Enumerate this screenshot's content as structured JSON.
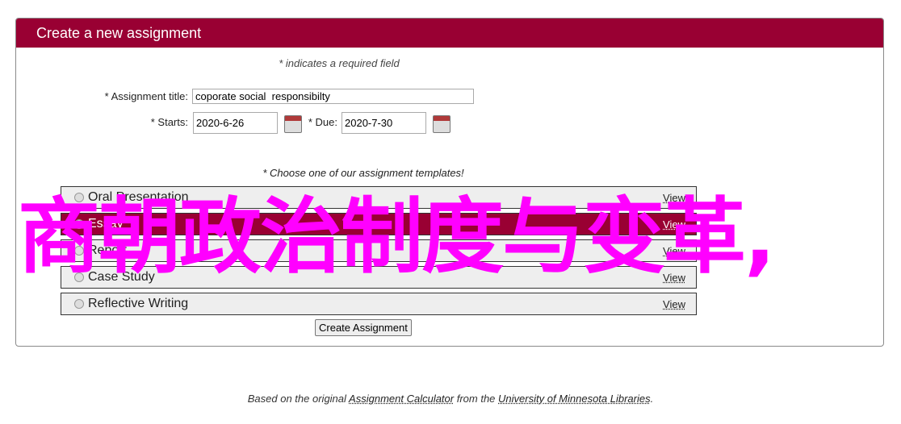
{
  "header": {
    "title": "Create a new assignment"
  },
  "form": {
    "required_note": "* indicates a required field",
    "title_label": "* Assignment title:",
    "title_value": "coporate social  responsibilty",
    "starts_label": "* Starts:",
    "starts_value": "2020-6-26",
    "due_label": "* Due:",
    "due_value": "2020-7-30",
    "choose_label": "* Choose one of our assignment templates!",
    "templates": [
      {
        "name": "Oral Presentation",
        "view": "View",
        "selected": false
      },
      {
        "name": "Essay",
        "view": "View",
        "selected": true
      },
      {
        "name": "Report",
        "view": "View",
        "selected": false
      },
      {
        "name": "Case Study",
        "view": "View",
        "selected": false
      },
      {
        "name": "Reflective Writing",
        "view": "View",
        "selected": false
      }
    ],
    "create_button": "Create Assignment"
  },
  "overlay_text": "商朝政治制度与变革,",
  "footer": {
    "prefix": "Based on the original ",
    "link1": "Assignment Calculator",
    "middle": " from the ",
    "link2": "University of Minnesota Libraries",
    "suffix": "."
  },
  "colors": {
    "brand": "#990033",
    "overlay": "#ff00ff"
  }
}
